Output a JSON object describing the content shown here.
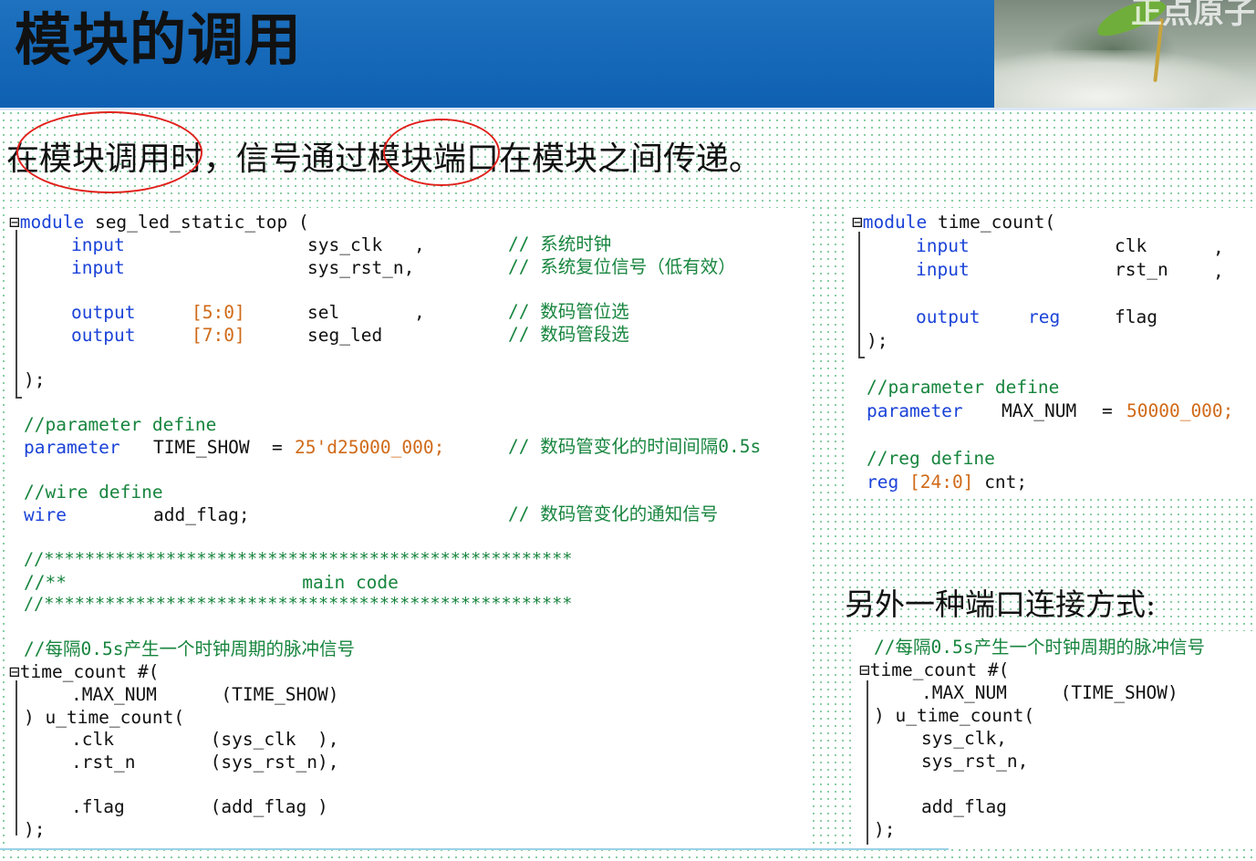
{
  "header": {
    "title": "模块的调用",
    "watermark": "正点原子"
  },
  "intro": {
    "text": "在模块调用时，信号通过模块端口在模块之间传递。"
  },
  "left_code": {
    "module_name": "seg_led_static_top",
    "port_lines": [
      {
        "dir": "input",
        "width": "",
        "name": "sys_clk",
        "comment": "// 系统时钟"
      },
      {
        "dir": "input",
        "width": "",
        "name": "sys_rst_n,",
        "comment": "// 系统复位信号（低有效）"
      },
      {
        "dir": "output",
        "width": "[5:0]",
        "name": "sel",
        "comment": "// 数码管位选"
      },
      {
        "dir": "output",
        "width": "[7:0]",
        "name": "seg_led",
        "comment": "// 数码管段选"
      }
    ],
    "param_comment": "//parameter define",
    "param_line": {
      "kw": "parameter",
      "name": "TIME_SHOW",
      "eq": "=",
      "value": "25'd25000_000;",
      "comment": "// 数码管变化的时间间隔0.5s"
    },
    "wire_comment": "//wire define",
    "wire_line": {
      "kw": "wire",
      "name": "add_flag;",
      "comment": "// 数码管变化的通知信号"
    },
    "banner_stars": "//****************************************************",
    "banner_mid": "//**                      main code",
    "pulse_comment": "//每隔0.5s产生一个时钟周期的脉冲信号",
    "inst_head": "time_count #(",
    "inst_param": ".MAX_NUM      (TIME_SHOW)",
    "inst_name": ") u_time_count(",
    "inst_clk": ".clk         (sys_clk  ),",
    "inst_rst": ".rst_n       (sys_rst_n),",
    "inst_flag": ".flag        (add_flag )",
    "close": ");"
  },
  "right_code": {
    "module_name": "time_count(",
    "port_lines": [
      {
        "dir": "input",
        "name": "clk",
        "sep": ","
      },
      {
        "dir": "input",
        "name": "rst_n",
        "sep": ","
      },
      {
        "dir": "output",
        "reg": "reg",
        "name": "flag",
        "sep": ""
      }
    ],
    "close": ");",
    "param_comment": "//parameter define",
    "param_line": {
      "kw": "parameter",
      "name": "MAX_NUM",
      "eq": "=",
      "value": "50000_000;"
    },
    "reg_comment": "//reg define",
    "reg_line": {
      "kw": "reg",
      "width": "[24:0]",
      "name": "cnt;"
    }
  },
  "alt_note": "另外一种端口连接方式:",
  "alt_code": {
    "comment": "//每隔0.5s产生一个时钟周期的脉冲信号",
    "head": "time_count #(",
    "param": ".MAX_NUM     (TIME_SHOW)",
    "inst": ") u_time_count(",
    "a1": "sys_clk,",
    "a2": "sys_rst_n,",
    "a3": "add_flag",
    "close": ");"
  },
  "colors": {
    "keyword": "#1b43d8",
    "comment": "#17853e",
    "number": "#d06a18",
    "header": "#1468b8",
    "annotation": "#e0211c"
  }
}
